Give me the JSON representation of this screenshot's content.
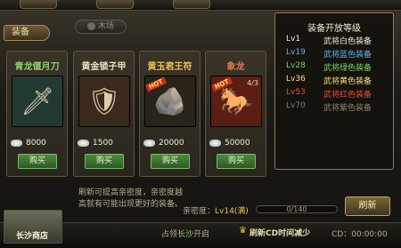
{
  "top": {
    "equip_tab": "装备",
    "mini_tab": "木场"
  },
  "cards": [
    {
      "name": "青龙偃月刀",
      "name_color": "#8fd070",
      "icon": "🗡",
      "img_bg": "#233a32",
      "price": "8000",
      "buy": "购买",
      "hot": "",
      "fragment": ""
    },
    {
      "name": "黄金锁子甲",
      "name_color": "#e6e0c4",
      "icon": "🛡",
      "img_bg": "#3a2a1c",
      "price": "1500",
      "buy": "购买",
      "hot": "",
      "fragment": ""
    },
    {
      "name": "黄玉君王符",
      "name_color": "#e8c25a",
      "icon": "🪨",
      "img_bg": "#2a2418",
      "price": "20000",
      "buy": "购买",
      "hot": "HOT",
      "fragment": ""
    },
    {
      "name": "象龙",
      "name_color": "#e07a4a",
      "icon": "🐎",
      "img_bg": "#5a1f12",
      "price": "50000",
      "buy": "购买",
      "hot": "HOT",
      "fragment": "4/3"
    }
  ],
  "popup": {
    "title": "装备开放等级",
    "rows": [
      {
        "lv": "Lv1",
        "name": "武将白色装备",
        "color": "#f0ecd8"
      },
      {
        "lv": "Lv19",
        "name": "武将蓝色装备",
        "color": "#5fb1ef"
      },
      {
        "lv": "Lv28",
        "name": "武将绿色装备",
        "color": "#7fd06a"
      },
      {
        "lv": "Lv36",
        "name": "武将黄色装备",
        "color": "#f3e07a"
      },
      {
        "lv": "Lv53",
        "name": "武将红色装备",
        "color": "#e84c3e"
      },
      {
        "lv": "Lv70",
        "name": "武将紫色装备",
        "color": "#8a8377"
      }
    ]
  },
  "dialogs": {
    "line1": "刷新可提高亲密度，亲密度越",
    "line2": "高就有可能出现更好的装备。"
  },
  "intimacy": {
    "label": "亲密度：",
    "level": "Lv14(满)",
    "progress_text": "0/140"
  },
  "refresh_button": "刷新",
  "bottom": {
    "city": "长沙商店",
    "occupy_pre": "占领",
    "occupy_city": "长沙",
    "occupy_post": "开启",
    "reduce": "刷新CD时间减少",
    "cd": "CD：00:00:00"
  }
}
